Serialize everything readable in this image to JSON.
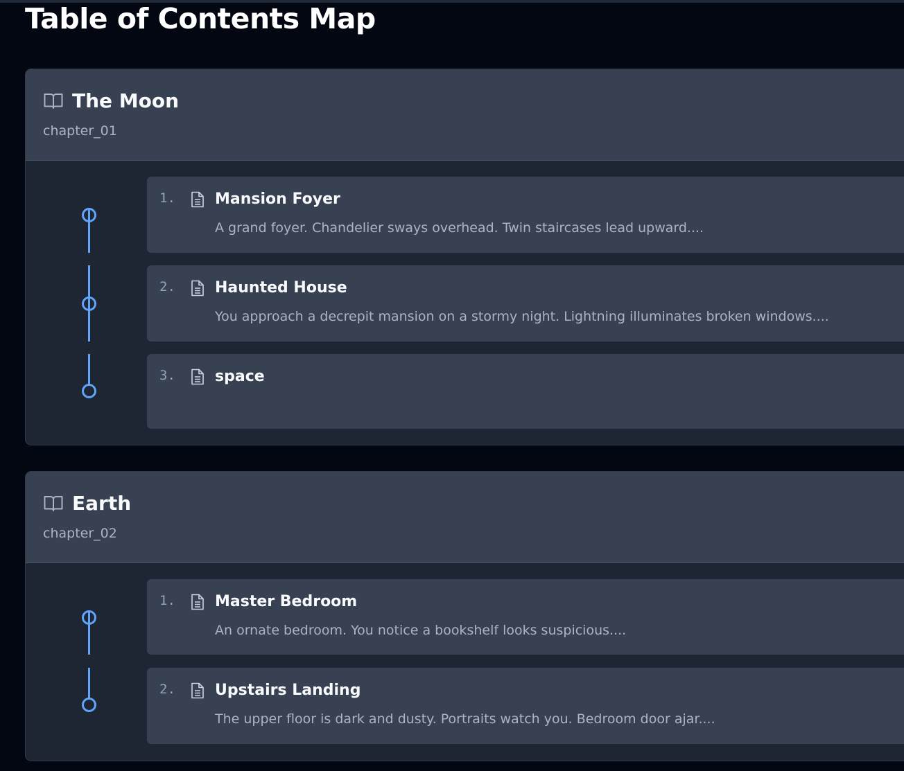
{
  "page": {
    "title": "Table of Contents Map"
  },
  "chapters": [
    {
      "title": "The Moon",
      "id": "chapter_01",
      "icon": "book-open-icon",
      "scenes": [
        {
          "number": "1.",
          "title": "Mansion Foyer",
          "description": "A grand foyer. Chandelier sways overhead. Twin staircases lead upward...."
        },
        {
          "number": "2.",
          "title": "Haunted House",
          "description": "You approach a decrepit mansion on a stormy night. Lightning illuminates broken windows...."
        },
        {
          "number": "3.",
          "title": "space",
          "description": ""
        }
      ]
    },
    {
      "title": "Earth",
      "id": "chapter_02",
      "icon": "book-open-icon",
      "scenes": [
        {
          "number": "1.",
          "title": "Master Bedroom",
          "description": "An ornate bedroom. You notice a bookshelf looks suspicious...."
        },
        {
          "number": "2.",
          "title": "Upstairs Landing",
          "description": "The upper floor is dark and dusty. Portraits watch you. Bedroom door ajar...."
        }
      ]
    }
  ],
  "colors": {
    "background": "#030712",
    "card": "#384152",
    "accent": "#60a5fa",
    "muted": "#aab4c3"
  }
}
